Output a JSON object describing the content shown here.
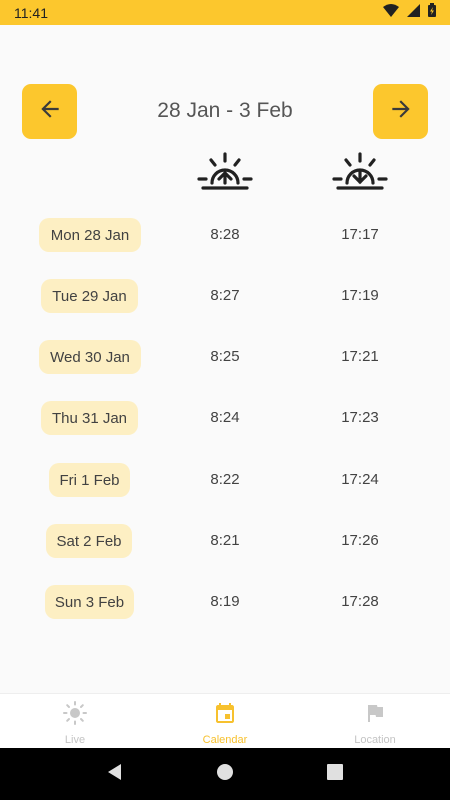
{
  "status_bar": {
    "time": "11:41"
  },
  "header": {
    "week_range": "28 Jan - 3 Feb"
  },
  "days": [
    {
      "day": "Mon 28 Jan",
      "sunrise": "8:28",
      "sunset": "17:17"
    },
    {
      "day": "Tue 29 Jan",
      "sunrise": "8:27",
      "sunset": "17:19"
    },
    {
      "day": "Wed 30 Jan",
      "sunrise": "8:25",
      "sunset": "17:21"
    },
    {
      "day": "Thu 31 Jan",
      "sunrise": "8:24",
      "sunset": "17:23"
    },
    {
      "day": "Fri 1 Feb",
      "sunrise": "8:22",
      "sunset": "17:24"
    },
    {
      "day": "Sat 2 Feb",
      "sunrise": "8:21",
      "sunset": "17:26"
    },
    {
      "day": "Sun 3 Feb",
      "sunrise": "8:19",
      "sunset": "17:28"
    }
  ],
  "bottom_nav": {
    "live": "Live",
    "calendar": "Calendar",
    "location": "Location"
  },
  "colors": {
    "accent": "#fcc72d",
    "pill": "#fdefc3",
    "active_tab": "#f7c12e"
  },
  "icons": [
    "wifi-icon",
    "signal-icon",
    "battery-icon",
    "arrow-left-icon",
    "arrow-right-icon",
    "sunrise-icon",
    "sunset-icon",
    "sun-icon",
    "calendar-icon",
    "flag-icon",
    "back-icon",
    "home-icon",
    "recents-icon"
  ]
}
